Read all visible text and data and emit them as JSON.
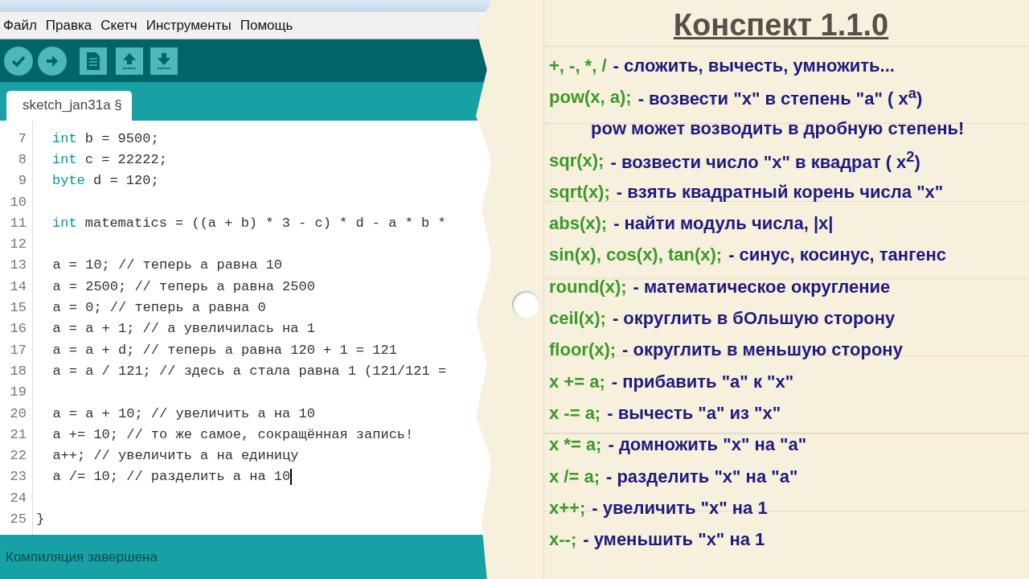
{
  "menu": [
    "Файл",
    "Правка",
    "Скетч",
    "Инструменты",
    "Помощь"
  ],
  "toolbar": [
    {
      "kind": "verify"
    },
    {
      "kind": "upload"
    },
    {
      "kind": "new"
    },
    {
      "kind": "open"
    },
    {
      "kind": "save"
    }
  ],
  "tabs": [
    {
      "label": "sketch_jan31a §",
      "selected": true
    }
  ],
  "editor": {
    "lines": [
      {
        "number": "7",
        "keyword": "int",
        "code": " b = 9500;",
        "cursor": false
      },
      {
        "number": "8",
        "keyword": "int",
        "code": " c = 22222;",
        "cursor": false
      },
      {
        "number": "9",
        "keyword": "byte",
        "code": " d = 120;",
        "cursor": false
      },
      {
        "number": "10",
        "cursor": false
      },
      {
        "number": "11",
        "keyword": "int",
        "code": " matematics = ((a + b) * 3 - c) * d - a * b *",
        "cursor": false
      },
      {
        "number": "12",
        "cursor": false
      },
      {
        "number": "13",
        "code": "  a = 10; // теперь а равна 10",
        "cursor": false
      },
      {
        "number": "14",
        "code": "  a = 2500; // теперь а равна 2500",
        "cursor": false
      },
      {
        "number": "15",
        "code": "  a = 0; // теперь а равна 0",
        "cursor": false
      },
      {
        "number": "16",
        "code": "  a = a + 1; // а увеличилась на 1",
        "cursor": false
      },
      {
        "number": "17",
        "code": "  a = a + d; // теперь а равна 120 + 1 = 121",
        "cursor": false
      },
      {
        "number": "18",
        "code": "  a = a / 121; // здесь а стала равна 1 (121/121 =",
        "cursor": false
      },
      {
        "number": "19",
        "cursor": false
      },
      {
        "number": "20",
        "code": "  a = a + 10; // увеличить а на 10",
        "cursor": false
      },
      {
        "number": "21",
        "code": "  a += 10; // то же самое, сокращённая запись!",
        "cursor": false
      },
      {
        "number": "22",
        "code": "  a++; // увеличить а на единицу",
        "cursor": false
      },
      {
        "number": "23",
        "code": "  a /= 10; // разделить а на 10",
        "cursor": true
      },
      {
        "number": "24",
        "cursor": false
      },
      {
        "number": "25",
        "code": "}",
        "cursor": false
      }
    ]
  },
  "status_bar": "Компиляция завершена",
  "notes": {
    "title": "Конспект 1.1.0",
    "entries": [
      {
        "kind": "entry",
        "code": "+, -, *, /",
        "description": "- сложить, вычесть, умножить..."
      },
      {
        "kind": "entry",
        "code": "pow(x, a);",
        "description": "- возвести \"x\" в степень \"a\" ( x$^{a}$)"
      },
      {
        "kind": "note",
        "description": "pow может возводить в дробную степень!"
      },
      {
        "kind": "entry",
        "code": "sqr(x);",
        "description": "- возвести число \"x\" в квадрат ( x$^{2}$)"
      },
      {
        "kind": "entry",
        "code": "sqrt(x);",
        "description": "- взять квадратный корень числа \"x\""
      },
      {
        "kind": "entry",
        "code": "abs(x);",
        "description": "- найти модуль числа, |x|"
      },
      {
        "kind": "entry",
        "code": "sin(x), cos(x), tan(x);",
        "description": "- синус, косинус, тангенс"
      },
      {
        "kind": "entry",
        "code": "round(x);",
        "description": "- математическое округление"
      },
      {
        "kind": "entry",
        "code": "ceil(x);",
        "description": "- округлить в бОльшую сторону"
      },
      {
        "kind": "entry",
        "code": "floor(x);",
        "description": "- округлить в меньшую сторону"
      },
      {
        "kind": "entry",
        "code": "x += a;",
        "description": "- прибавить \"a\" к \"x\""
      },
      {
        "kind": "entry",
        "code": "x -= a;",
        "description": "- вычесть \"a\" из \"x\""
      },
      {
        "kind": "entry",
        "code": "x *= a;",
        "description": "- домножить \"x\" на \"a\""
      },
      {
        "kind": "entry",
        "code": "x /= a;",
        "description": "- разделить \"x\" на \"a\""
      },
      {
        "kind": "entry",
        "code": "x++;",
        "description": "- увеличить \"x\" на 1"
      },
      {
        "kind": "entry",
        "code": "x--;",
        "description": "- уменьшить \"x\" на 1"
      }
    ]
  }
}
